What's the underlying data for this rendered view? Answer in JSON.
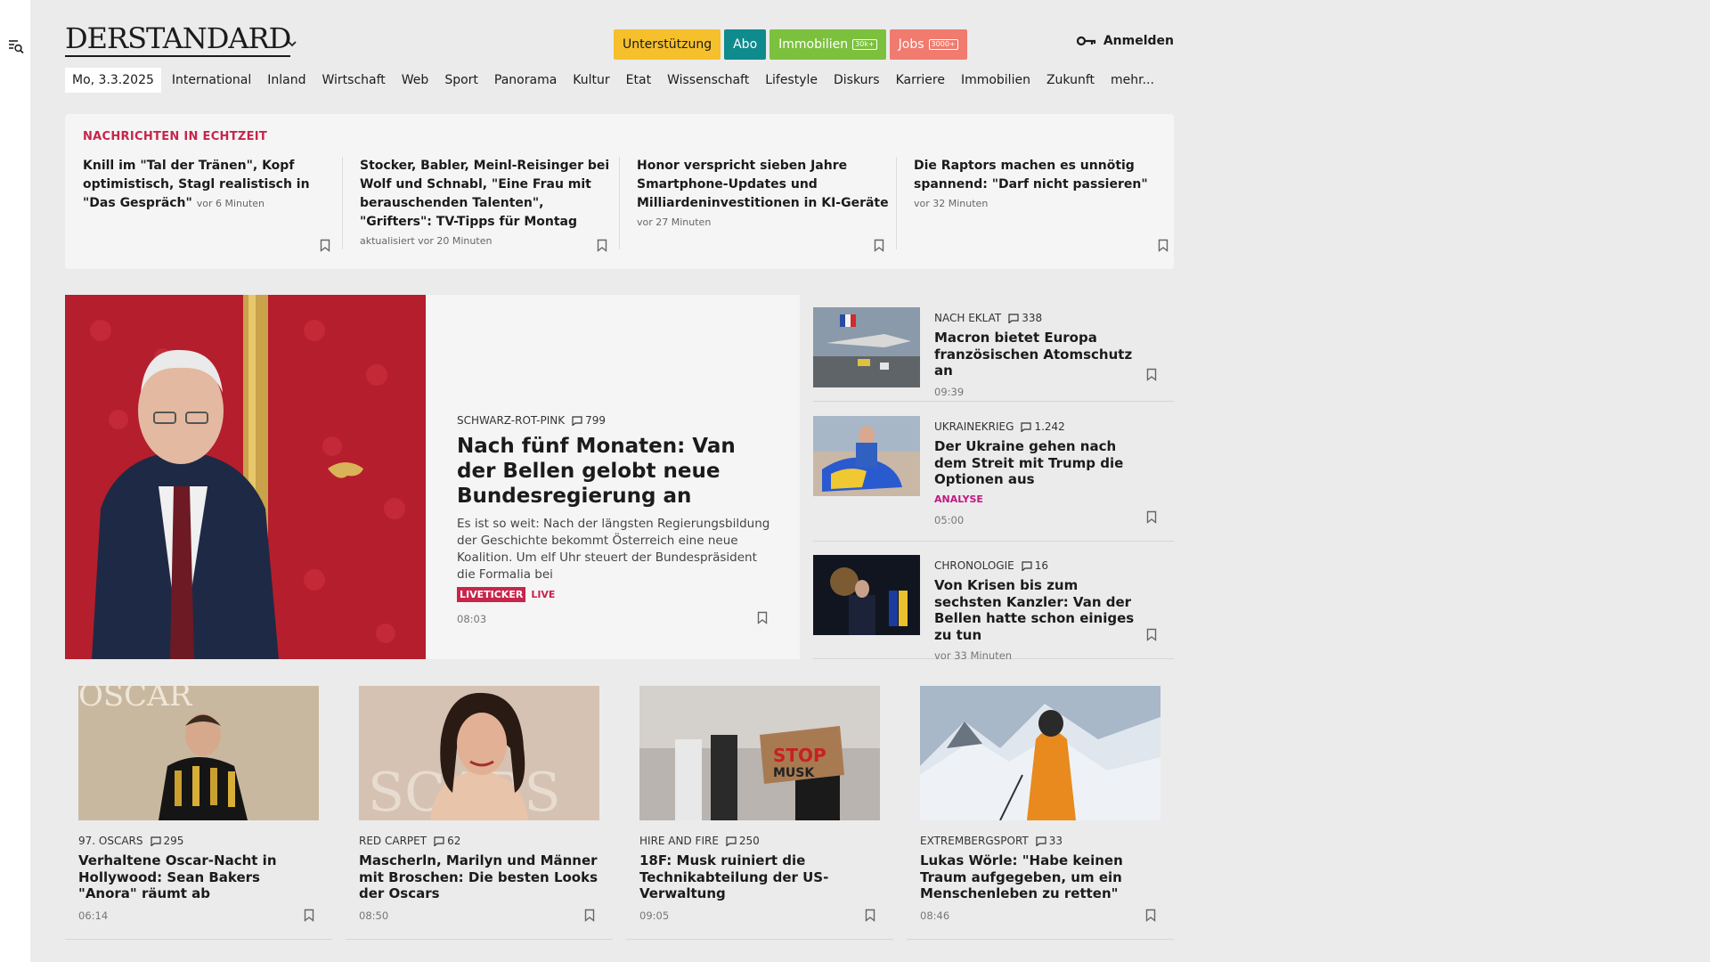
{
  "brand": {
    "logo": "DERSTANDARD"
  },
  "top_buttons": [
    {
      "label": "Unterstützung",
      "bg": "#f5c02b",
      "fg": "#1b1b1b",
      "badge": ""
    },
    {
      "label": "Abo",
      "bg": "#0f8b8d",
      "fg": "#ffffff",
      "badge": ""
    },
    {
      "label": "Immobilien",
      "bg": "#7cc13d",
      "fg": "#ffffff",
      "badge": "30k+"
    },
    {
      "label": "Jobs",
      "bg": "#f07b6e",
      "fg": "#ffffff",
      "badge": "3000+"
    }
  ],
  "login_label": "Anmelden",
  "nav": {
    "date": "Mo, 3.3.2025",
    "items": [
      "International",
      "Inland",
      "Wirtschaft",
      "Web",
      "Sport",
      "Panorama",
      "Kultur",
      "Etat",
      "Wissenschaft",
      "Lifestyle",
      "Diskurs",
      "Karriere",
      "Immobilien",
      "Zukunft",
      "mehr..."
    ]
  },
  "ticker": {
    "title": "NACHRICHTEN IN ECHTZEIT",
    "items": [
      {
        "text": "Knill im \"Tal der Tränen\", Kopf optimistisch, Stagl realistisch in \"Das Gespräch\"",
        "time": "vor 6 Minuten"
      },
      {
        "text": "Stocker, Babler, Meinl-Reisinger bei Wolf und Schnabl, \"Eine Frau mit berauschenden Talenten\", \"Grifters\": TV-Tipps für Montag",
        "time": "aktualisiert vor 20 Minuten"
      },
      {
        "text": "Honor verspricht sieben Jahre Smartphone-Updates und Milliardeninvestitionen in KI-Geräte",
        "time": "vor 27 Minuten"
      },
      {
        "text": "Die Raptors machen es unnötig spannend: \"Darf nicht passieren\"",
        "time": "vor 32 Minuten"
      }
    ]
  },
  "hero": {
    "kicker": "SCHWARZ-ROT-PINK",
    "comments": "799",
    "title": "Nach fünf Monaten: Van der Bellen gelobt neue Bundesregierung an",
    "lead": "Es ist so weit: Nach der längsten Regierungsbildung der Geschichte bekommt Österreich eine neue Koalition. Um elf Uhr steuert der Bundespräsident die Formalia bei",
    "liveticker": "LIVETICKER",
    "live": "LIVE",
    "time": "08:03"
  },
  "side": [
    {
      "kicker": "NACH EKLAT",
      "comments": "338",
      "title": "Macron bietet Europa französischen Atomschutz an",
      "extra": "",
      "time": "09:39"
    },
    {
      "kicker": "UKRAINEKRIEG",
      "comments": "1.242",
      "title": "Der Ukraine gehen nach dem Streit mit Trump die Optionen aus",
      "extra": "ANALYSE",
      "time": "05:00"
    },
    {
      "kicker": "CHRONOLOGIE",
      "comments": "16",
      "title": "Von Krisen bis zum sechsten Kanzler: Van der Bellen hatte schon einiges zu tun",
      "extra": "",
      "time": "vor 33 Minuten"
    }
  ],
  "cards": [
    {
      "kicker": "97. OSCARS",
      "comments": "295",
      "title": "Verhaltene Oscar-Nacht in Hollywood: Sean Bakers \"Anora\" räumt ab",
      "time": "06:14"
    },
    {
      "kicker": "RED CARPET",
      "comments": "62",
      "title": "Mascherln, Marilyn und Männer mit Broschen: Die besten Looks der Oscars",
      "time": "08:50"
    },
    {
      "kicker": "HIRE AND FIRE",
      "comments": "250",
      "title": "18F: Musk ruiniert die Technikabteilung der US-Verwaltung",
      "time": "09:05"
    },
    {
      "kicker": "EXTREMBERGSPORT",
      "comments": "33",
      "title": "Lukas Wörle: \"Habe keinen Traum aufgegeben, um ein Menschenleben zu retten\"",
      "time": "08:46"
    }
  ],
  "colors": {
    "accent_red": "#c8254a",
    "analyse_pink": "#c01983",
    "background": "#ebebeb"
  }
}
